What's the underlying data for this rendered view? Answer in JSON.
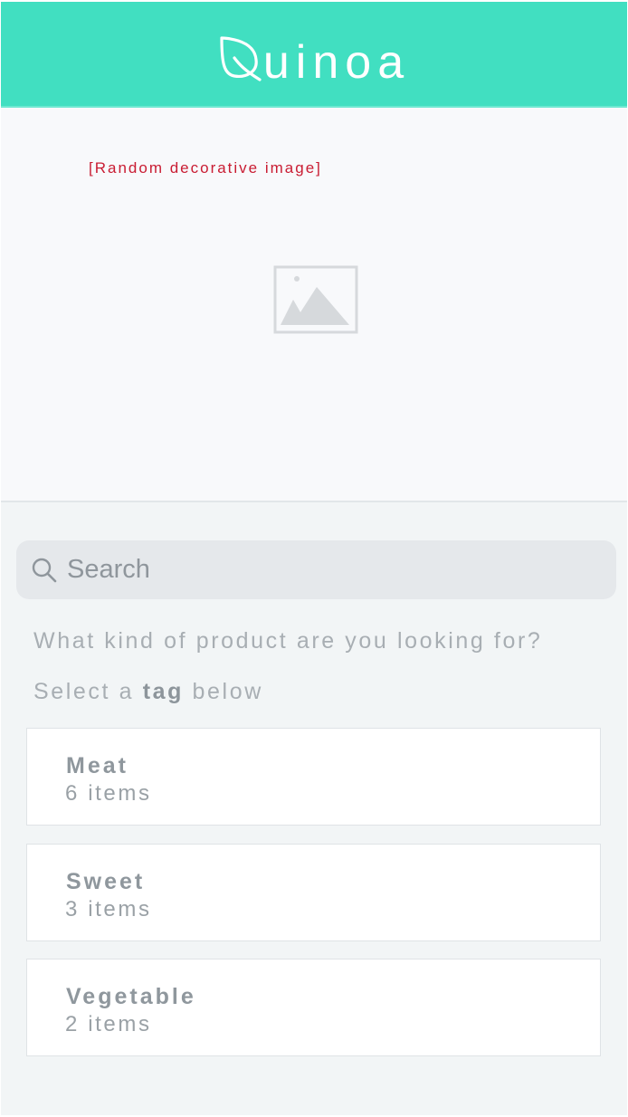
{
  "header": {
    "logo_text": "uinoa",
    "logo_icon": "leaf-q-icon",
    "background_color": "#41dfc1"
  },
  "hero": {
    "caption": "[Random decorative image]",
    "image_icon": "image-placeholder-icon"
  },
  "search": {
    "placeholder": "Search",
    "icon": "search-icon"
  },
  "prompt": {
    "question": "What kind of product are you looking for?",
    "select_prefix": "Select a",
    "select_bold": "tag",
    "select_suffix": "below"
  },
  "tags": [
    {
      "name": "Meat",
      "count": "6 items"
    },
    {
      "name": "Sweet",
      "count": "3 items"
    },
    {
      "name": "Vegetable",
      "count": "2 items"
    }
  ]
}
